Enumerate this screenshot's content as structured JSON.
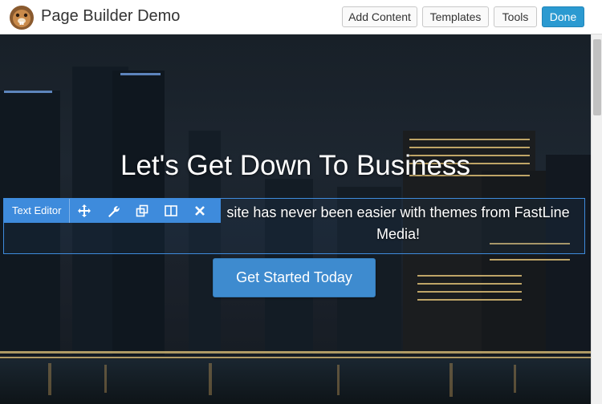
{
  "header": {
    "title": "Page Builder Demo",
    "logo_icon": "beaver-logo-icon",
    "buttons": {
      "add_content": "Add Content",
      "templates": "Templates",
      "tools": "Tools",
      "done": "Done"
    },
    "accent_color": "#2b9ad1"
  },
  "hero": {
    "heading": "Let's Get Down To Business",
    "body_text": "site has never been easier with themes from FastLine Media!",
    "cta_label": "Get Started Today",
    "cta_color": "#3e8bcf"
  },
  "module_toolbar": {
    "label": "Text Editor",
    "icons": [
      "move-icon",
      "wrench-icon",
      "duplicate-icon",
      "columns-icon",
      "close-icon"
    ],
    "color": "#3e8bdc"
  }
}
